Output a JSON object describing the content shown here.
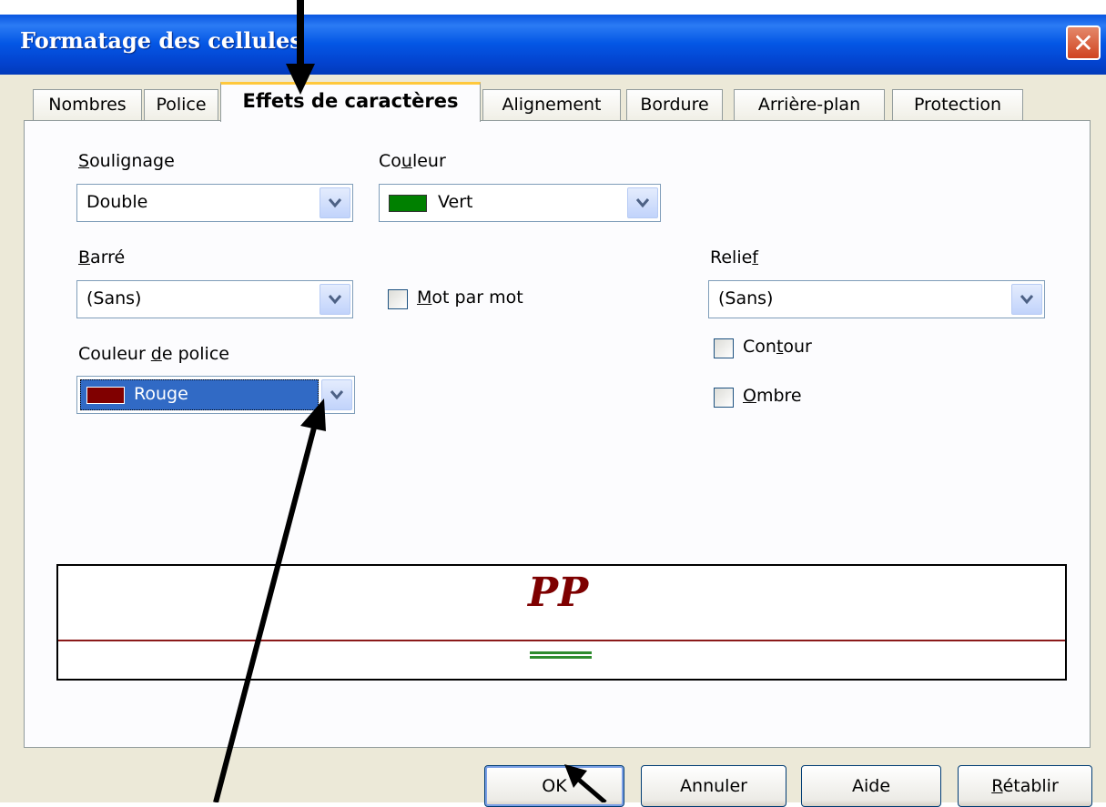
{
  "window": {
    "title": "Formatage des cellules",
    "close_glyph": "✕"
  },
  "tabs": [
    {
      "label": "Nombres",
      "active": false
    },
    {
      "label": "Police",
      "active": false
    },
    {
      "label": "Effets de caractères",
      "active": true
    },
    {
      "label": "Alignement",
      "active": false
    },
    {
      "label": "Bordure",
      "active": false
    },
    {
      "label": "Arrière-plan",
      "active": false
    },
    {
      "label": "Protection",
      "active": false
    }
  ],
  "fields": {
    "soulignage": {
      "label_mn": "S",
      "label_rest": "oulignage",
      "value": "Double"
    },
    "couleur": {
      "label_pre": "Co",
      "label_mn": "u",
      "label_rest": "leur",
      "value": "Vert",
      "swatch": "#008000"
    },
    "barre": {
      "label_mn": "B",
      "label_rest": "arré",
      "value": "(Sans)"
    },
    "mot_par_mot": {
      "label_mn": "M",
      "label_rest": "ot par mot",
      "checked": false
    },
    "relief": {
      "label_pre": "Relie",
      "label_mn": "f",
      "value": "(Sans)"
    },
    "couleur_police": {
      "label_pre": "Couleur ",
      "label_mn": "d",
      "label_rest": "e police",
      "value": "Rouge",
      "swatch": "#800000",
      "selected": true
    },
    "contour": {
      "label_pre": "Con",
      "label_mn": "t",
      "label_rest": "our",
      "checked": false
    },
    "ombre": {
      "label_mn": "O",
      "label_rest": "mbre",
      "checked": false
    }
  },
  "preview": {
    "text": "PP",
    "text_color": "#7e0000",
    "strike_color": "#8b1a1a",
    "underline_color": "#2e8b2e"
  },
  "buttons": {
    "ok": "OK",
    "annuler": "Annuler",
    "aide": "Aide",
    "retablir_mn": "R",
    "retablir_rest": "établir"
  },
  "colors": {
    "title_bar": "#0457e5",
    "dialog_bg": "#ece9d8",
    "selection": "#316ac5"
  }
}
